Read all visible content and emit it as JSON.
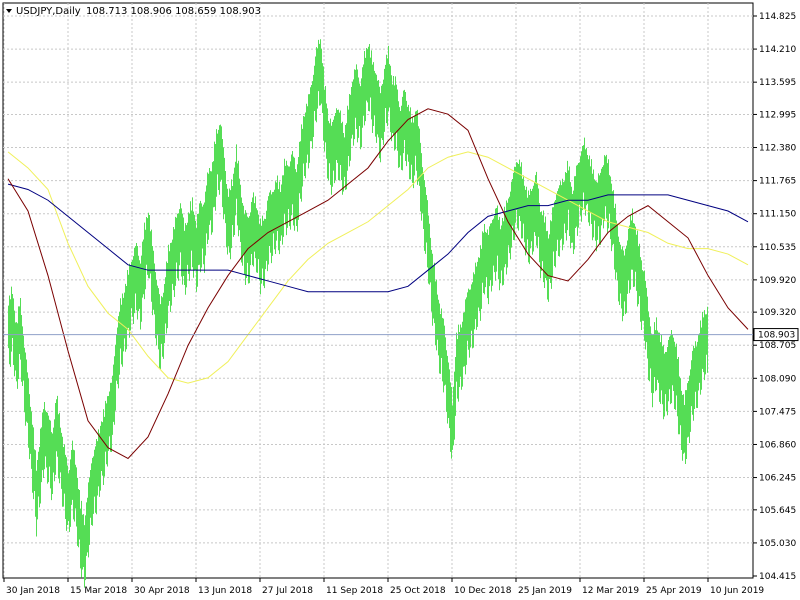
{
  "header": {
    "symbol": "USDJPY,Daily",
    "ohlc": "108.713 108.906 108.659 108.903",
    "dropdown_icon": "triangle-down-icon"
  },
  "colors": {
    "background": "#ffffff",
    "grid": "#c8c8c8",
    "bars": "#55dd55",
    "ma_fast": "#7a0000",
    "ma_mid": "#f0f05a",
    "ma_slow": "#000080",
    "price_line": "#8fa0c8",
    "current_label_bg": "#ffffff"
  },
  "chart_data": {
    "type": "line",
    "title": "",
    "xlabel": "",
    "ylabel": "",
    "ylim": [
      104.415,
      115.03
    ],
    "price_ticks": [
      "114.825",
      "114.210",
      "113.595",
      "112.995",
      "112.380",
      "111.765",
      "111.150",
      "110.535",
      "109.920",
      "109.320",
      "108.705",
      "108.090",
      "107.475",
      "106.860",
      "106.245",
      "105.645",
      "105.030",
      "104.415"
    ],
    "time_ticks": [
      "30 Jan 2018",
      "15 Mar 2018",
      "30 Apr 2018",
      "13 Jun 2018",
      "27 Jul 2018",
      "11 Sep 2018",
      "25 Oct 2018",
      "10 Dec 2018",
      "25 Jan 2019",
      "12 Mar 2019",
      "25 Apr 2019",
      "10 Jun 2019"
    ],
    "current_price": 108.903,
    "current_price_label": "108.903",
    "price_series": {
      "name": "",
      "x": [
        0,
        4,
        8,
        12,
        16,
        20,
        24,
        28,
        32,
        36,
        40,
        44,
        48,
        52,
        56,
        60,
        64,
        68,
        72,
        76,
        80,
        84,
        88,
        92,
        96,
        100,
        104,
        108,
        112,
        116,
        120,
        124,
        128,
        132,
        136,
        140,
        144,
        148,
        152,
        156,
        160,
        164,
        168,
        172,
        176,
        180,
        184,
        188,
        192,
        196,
        200,
        204,
        208,
        212,
        216,
        220,
        224,
        228,
        232,
        236,
        240,
        244,
        248,
        252,
        256,
        260,
        264,
        268,
        272,
        276,
        280,
        284,
        288,
        292,
        296,
        300,
        304,
        308,
        312,
        316,
        320,
        324,
        328,
        332,
        336,
        340,
        344,
        348,
        352,
        356,
        360,
        364,
        368,
        372,
        376,
        380,
        384,
        388,
        392,
        396,
        400,
        404,
        408,
        412,
        416,
        420,
        424,
        428,
        432,
        436,
        440,
        444,
        448,
        452,
        456,
        460,
        464,
        468,
        472,
        476,
        480,
        484,
        488,
        492,
        496,
        500,
        504,
        508,
        512,
        516,
        520,
        524,
        528,
        532,
        536,
        540,
        544,
        548,
        552,
        556,
        560,
        564,
        568,
        572,
        576,
        580,
        584,
        588,
        592,
        596,
        600,
        604,
        608,
        612,
        616,
        620,
        624,
        628,
        632,
        636,
        640,
        644,
        648,
        652,
        656,
        660,
        664,
        668,
        672,
        676,
        680,
        684,
        688,
        692,
        696,
        700,
        704,
        708,
        712,
        716,
        720,
        724,
        728,
        732,
        736,
        740
      ],
      "values": [
        109.0,
        109.3,
        108.6,
        109.1,
        108.2,
        107.6,
        106.8,
        106.0,
        106.6,
        107.2,
        106.9,
        106.6,
        107.3,
        106.8,
        106.3,
        105.9,
        106.4,
        106.0,
        105.3,
        105.0,
        105.6,
        106.2,
        106.4,
        106.8,
        107.0,
        107.4,
        107.6,
        108.5,
        109.0,
        109.3,
        109.6,
        109.9,
        110.1,
        109.8,
        110.4,
        110.8,
        110.1,
        109.5,
        109.0,
        109.4,
        110.0,
        110.3,
        110.6,
        110.9,
        110.4,
        110.7,
        110.9,
        110.5,
        110.9,
        110.9,
        111.5,
        111.6,
        112.2,
        112.4,
        111.7,
        111.0,
        111.3,
        111.9,
        111.2,
        110.7,
        110.6,
        111.0,
        110.9,
        110.5,
        110.6,
        111.0,
        111.1,
        111.3,
        111.2,
        111.6,
        111.6,
        111.8,
        111.5,
        112.1,
        112.6,
        112.8,
        113.2,
        113.7,
        114.0,
        113.1,
        112.5,
        112.3,
        112.7,
        112.5,
        112.2,
        112.7,
        113.2,
        113.4,
        113.1,
        113.6,
        113.9,
        113.5,
        113.3,
        112.9,
        113.4,
        113.7,
        113.2,
        113.1,
        112.6,
        113.0,
        112.7,
        112.4,
        112.7,
        112.0,
        111.3,
        110.7,
        109.9,
        109.4,
        108.9,
        108.6,
        107.9,
        107.2,
        108.4,
        108.6,
        108.9,
        109.3,
        109.4,
        109.8,
        110.0,
        110.5,
        110.3,
        110.6,
        110.8,
        110.5,
        110.7,
        111.0,
        111.3,
        111.7,
        111.6,
        111.3,
        111.0,
        111.2,
        111.4,
        110.8,
        110.6,
        110.3,
        110.7,
        111.1,
        111.2,
        111.4,
        111.6,
        111.1,
        111.5,
        111.8,
        112.0,
        111.8,
        111.5,
        111.3,
        111.4,
        111.8,
        111.6,
        111.2,
        110.6,
        110.1,
        109.9,
        110.4,
        110.7,
        110.4,
        109.9,
        109.6,
        108.9,
        108.4,
        108.7,
        108.4,
        108.1,
        108.3,
        108.5,
        108.2,
        107.6,
        107.2,
        107.6,
        108.1,
        108.3,
        108.6,
        108.9
      ]
    },
    "ma_fast": {
      "name": "",
      "x": [
        0,
        20,
        40,
        60,
        80,
        100,
        120,
        140,
        160,
        180,
        200,
        220,
        240,
        260,
        280,
        300,
        320,
        340,
        360,
        380,
        400,
        420,
        440,
        460,
        480,
        500,
        520,
        540,
        560,
        580,
        600,
        620,
        640,
        660,
        680,
        700,
        720,
        740
      ],
      "values": [
        111.8,
        111.2,
        110.0,
        108.6,
        107.3,
        106.8,
        106.6,
        107.0,
        107.8,
        108.7,
        109.4,
        110.0,
        110.5,
        110.8,
        111.0,
        111.2,
        111.4,
        111.7,
        112.0,
        112.5,
        112.9,
        113.1,
        113.0,
        112.7,
        111.8,
        111.0,
        110.4,
        110.0,
        109.9,
        110.3,
        110.8,
        111.1,
        111.3,
        111.0,
        110.7,
        110.0,
        109.4,
        109.0
      ]
    },
    "ma_mid": {
      "name": "",
      "x": [
        0,
        20,
        40,
        60,
        80,
        100,
        120,
        140,
        160,
        180,
        200,
        220,
        240,
        260,
        280,
        300,
        320,
        340,
        360,
        380,
        400,
        420,
        440,
        460,
        480,
        500,
        520,
        540,
        560,
        580,
        600,
        620,
        640,
        660,
        680,
        700,
        720,
        740
      ],
      "values": [
        112.3,
        112.0,
        111.6,
        110.6,
        109.8,
        109.3,
        109.0,
        108.5,
        108.1,
        108.0,
        108.1,
        108.4,
        108.9,
        109.4,
        109.9,
        110.3,
        110.6,
        110.8,
        111.0,
        111.3,
        111.6,
        112.0,
        112.2,
        112.3,
        112.2,
        112.0,
        111.8,
        111.6,
        111.4,
        111.2,
        111.0,
        110.9,
        110.8,
        110.6,
        110.5,
        110.5,
        110.4,
        110.2
      ]
    },
    "ma_slow": {
      "name": "",
      "x": [
        0,
        20,
        40,
        60,
        80,
        100,
        120,
        140,
        160,
        180,
        200,
        220,
        240,
        260,
        280,
        300,
        320,
        340,
        360,
        380,
        400,
        420,
        440,
        460,
        480,
        500,
        520,
        540,
        560,
        580,
        600,
        620,
        640,
        660,
        680,
        700,
        720,
        740
      ],
      "values": [
        111.7,
        111.6,
        111.4,
        111.1,
        110.8,
        110.5,
        110.2,
        110.1,
        110.1,
        110.1,
        110.1,
        110.1,
        110.0,
        109.9,
        109.8,
        109.7,
        109.7,
        109.7,
        109.7,
        109.7,
        109.8,
        110.1,
        110.4,
        110.8,
        111.1,
        111.2,
        111.3,
        111.3,
        111.4,
        111.4,
        111.5,
        111.5,
        111.5,
        111.5,
        111.4,
        111.3,
        111.2,
        111.0
      ]
    }
  }
}
